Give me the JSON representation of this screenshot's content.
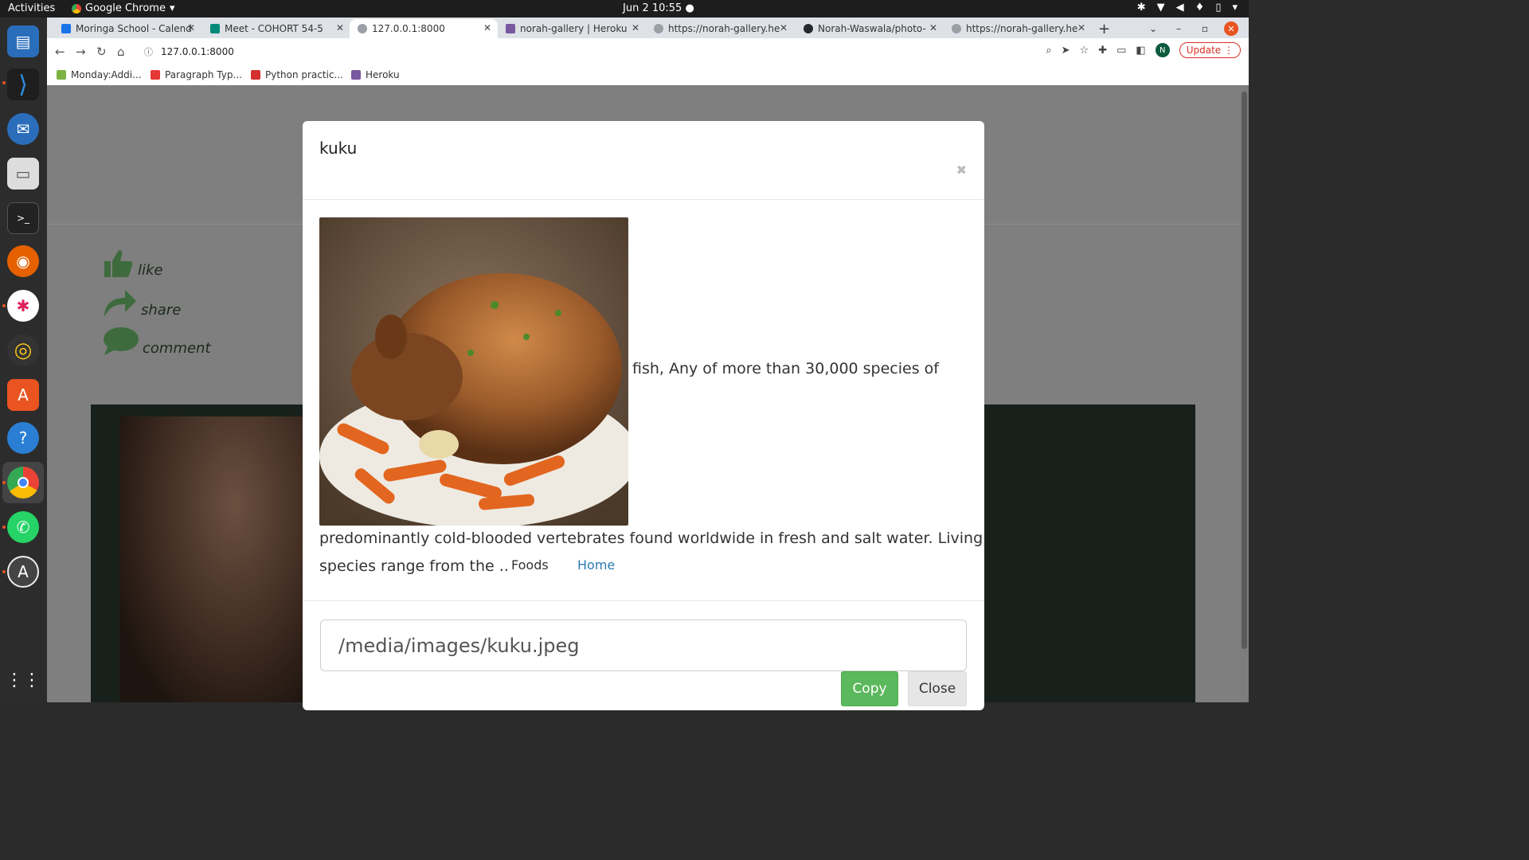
{
  "system": {
    "activities": "Activities",
    "app_name": "Google Chrome",
    "clock": "Jun 2  10:55"
  },
  "browser": {
    "tabs": [
      {
        "label": "Moringa School - Calend",
        "color": "#1a73e8"
      },
      {
        "label": "Meet - COHORT 54-5",
        "color": "#00897b"
      },
      {
        "label": "127.0.0.1:8000",
        "color": "#5f6368"
      },
      {
        "label": "norah-gallery | Heroku",
        "color": "#79589f"
      },
      {
        "label": "https://norah-gallery.he",
        "color": "#5f6368"
      },
      {
        "label": "Norah-Waswala/photo-",
        "color": "#24292e"
      },
      {
        "label": "https://norah-gallery.he",
        "color": "#5f6368"
      }
    ],
    "url": "127.0.0.1:8000",
    "update_label": "Update",
    "avatar_letter": "N",
    "bookmarks": [
      {
        "label": "Monday:Addi...",
        "color": "#7cb342"
      },
      {
        "label": "Paragraph Typ...",
        "color": "#e53935"
      },
      {
        "label": "Python practic...",
        "color": "#d32f2f"
      },
      {
        "label": "Heroku",
        "color": "#79589f"
      }
    ]
  },
  "page": {
    "actions": {
      "like": "like",
      "share": "share",
      "comment": "comment"
    }
  },
  "modal": {
    "title": "kuku",
    "close_symbol": "✖",
    "description_line1": "fish, Any of more than 30,000 species of",
    "description_line2": "predominantly cold-blooded vertebrates found worldwide in fresh and salt water. Living",
    "description_line3": "species range from the ..",
    "category": "Foods",
    "location": "Home",
    "image_path": "/media/images/kuku.jpeg",
    "copy_label": "Copy",
    "close_label": "Close"
  }
}
